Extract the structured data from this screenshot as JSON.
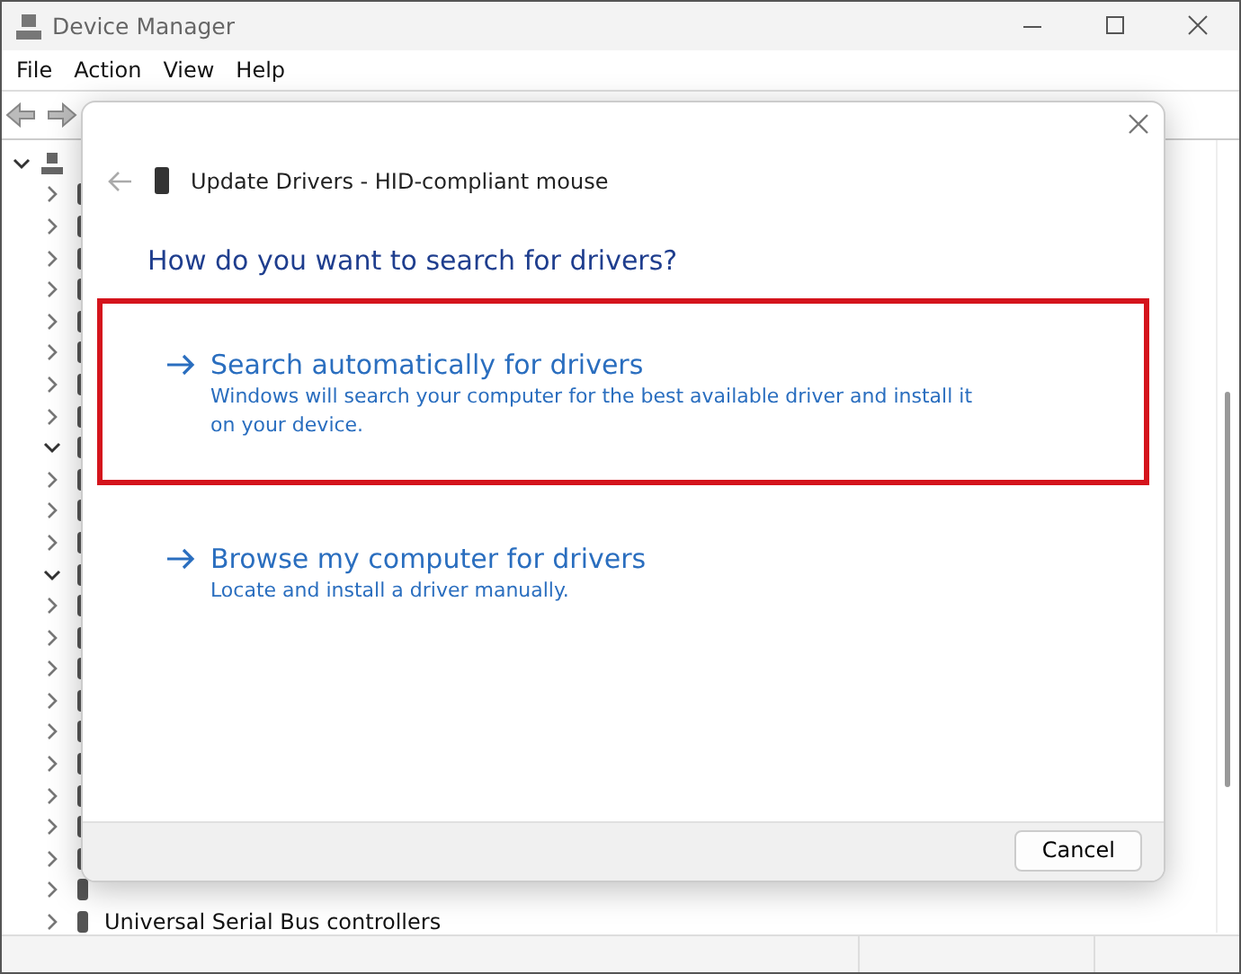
{
  "window": {
    "title": "Device Manager"
  },
  "menu": [
    "File",
    "Action",
    "View",
    "Help"
  ],
  "tree": {
    "root": {
      "expanded": true
    },
    "items": [
      {
        "expanded": false
      },
      {
        "expanded": false
      },
      {
        "expanded": false
      },
      {
        "expanded": false
      },
      {
        "expanded": false
      },
      {
        "expanded": false
      },
      {
        "expanded": false
      },
      {
        "expanded": false
      },
      {
        "expanded": true
      },
      {
        "expanded": false
      },
      {
        "expanded": false
      },
      {
        "expanded": false
      },
      {
        "expanded": true
      },
      {
        "expanded": false
      },
      {
        "expanded": false
      },
      {
        "expanded": false
      },
      {
        "expanded": false
      },
      {
        "expanded": false
      },
      {
        "expanded": false
      },
      {
        "expanded": false
      },
      {
        "expanded": false
      },
      {
        "expanded": false
      },
      {
        "expanded": false
      },
      {
        "expanded": false,
        "label": "Universal Serial Bus controllers"
      }
    ]
  },
  "dialog": {
    "title": "Update Drivers - HID-compliant mouse",
    "heading": "How do you want to search for drivers?",
    "options": [
      {
        "title": "Search automatically for drivers",
        "description": "Windows will search your computer for the best available driver and install it on your device.",
        "highlighted": true
      },
      {
        "title": "Browse my computer for drivers",
        "description": "Locate and install a driver manually.",
        "highlighted": false
      }
    ],
    "buttons": [
      "Cancel"
    ]
  }
}
